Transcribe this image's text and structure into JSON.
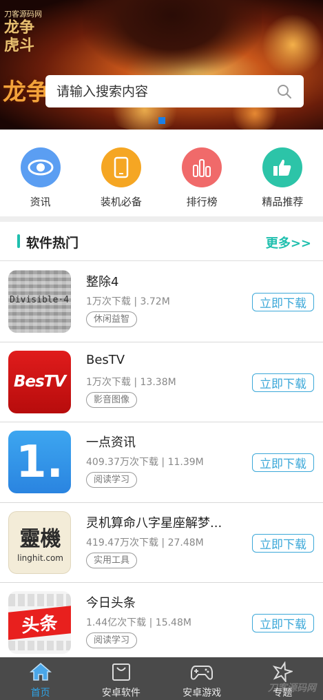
{
  "banner": {
    "logo_top": "刀客源码网",
    "logo_main": "龙争虎斗",
    "side_title": "龙争",
    "search_placeholder": "请输入搜索内容",
    "active_dot_color": "#1b7fe6"
  },
  "categories": [
    {
      "label": "资讯",
      "icon": "eye-icon",
      "color": "#5b9ef2"
    },
    {
      "label": "装机必备",
      "icon": "phone-icon",
      "color": "#f5a623"
    },
    {
      "label": "排行榜",
      "icon": "bar-chart-icon",
      "color": "#f06a6a"
    },
    {
      "label": "精品推荐",
      "icon": "thumbs-up-icon",
      "color": "#2cc4a8"
    }
  ],
  "section": {
    "title": "软件热门",
    "more": "更多>>",
    "accent": "#1fbfae"
  },
  "apps": [
    {
      "name": "整除4",
      "meta": "1万次下载 | 3.72M",
      "tag": "休闲益智",
      "download": "立即下载",
      "icon": "divisible-icon",
      "icon_text": "Divisible·4"
    },
    {
      "name": "BesTV",
      "meta": "1万次下载 | 13.38M",
      "tag": "影音图像",
      "download": "立即下载",
      "icon": "bestv-icon",
      "icon_text": "BesTV"
    },
    {
      "name": "一点资讯",
      "meta": "409.37万次下载 | 11.39M",
      "tag": "阅读学习",
      "download": "立即下载",
      "icon": "yidian-icon",
      "icon_text": "1."
    },
    {
      "name": "灵机算命八字星座解梦...",
      "meta": "419.47万次下载 | 27.48M",
      "tag": "实用工具",
      "download": "立即下载",
      "icon": "lingji-icon",
      "icon_text": "靈機",
      "icon_sub": "linghit.com"
    },
    {
      "name": "今日头条",
      "meta": "1.44亿次下载 | 15.48M",
      "tag": "阅读学习",
      "download": "立即下载",
      "icon": "toutiao-icon",
      "icon_text": "头条"
    }
  ],
  "tabs": [
    {
      "label": "首页",
      "icon": "home-icon",
      "active": true
    },
    {
      "label": "安卓软件",
      "icon": "bag-icon",
      "active": false
    },
    {
      "label": "安卓游戏",
      "icon": "gamepad-icon",
      "active": false
    },
    {
      "label": "专题",
      "icon": "star-icon",
      "active": false
    }
  ],
  "watermark": "刀客源码网"
}
